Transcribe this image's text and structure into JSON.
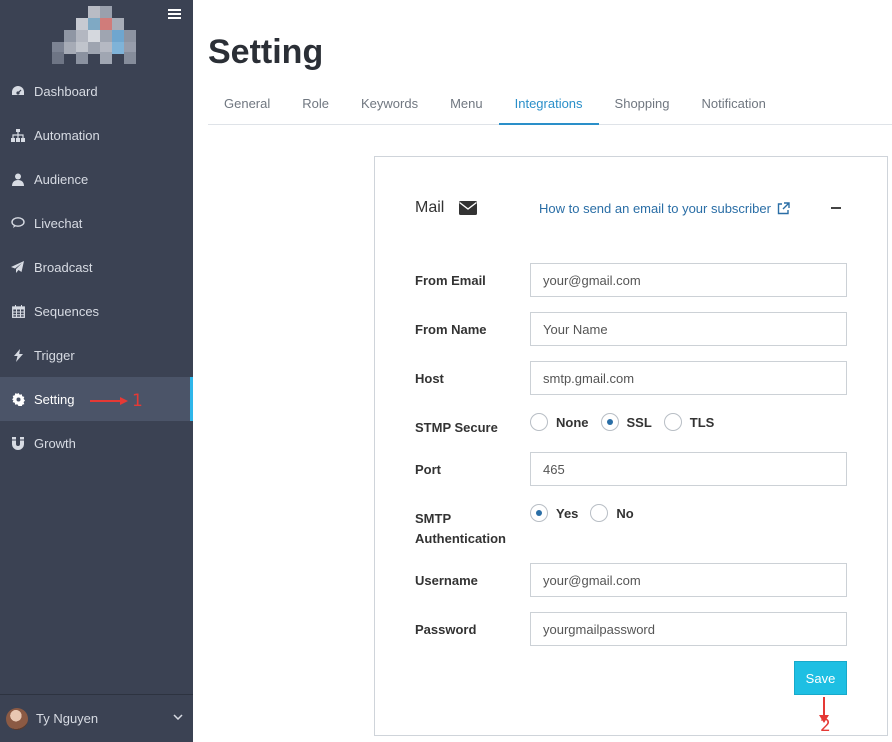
{
  "sidebar": {
    "items": [
      {
        "label": "Dashboard",
        "icon": "dashboard-icon"
      },
      {
        "label": "Automation",
        "icon": "sitemap-icon"
      },
      {
        "label": "Audience",
        "icon": "user-icon"
      },
      {
        "label": "Livechat",
        "icon": "chat-icon"
      },
      {
        "label": "Broadcast",
        "icon": "paper-plane-icon"
      },
      {
        "label": "Sequences",
        "icon": "calendar-icon"
      },
      {
        "label": "Trigger",
        "icon": "bolt-icon"
      },
      {
        "label": "Setting",
        "icon": "gear-icon"
      },
      {
        "label": "Growth",
        "icon": "magnet-icon"
      }
    ],
    "active": "Setting",
    "user_name": "Ty Nguyen"
  },
  "annotations": {
    "step1": "1",
    "step2": "2"
  },
  "page": {
    "title": "Setting"
  },
  "tabs": [
    {
      "label": "General"
    },
    {
      "label": "Role"
    },
    {
      "label": "Keywords"
    },
    {
      "label": "Menu"
    },
    {
      "label": "Integrations"
    },
    {
      "label": "Shopping"
    },
    {
      "label": "Notification"
    }
  ],
  "active_tab": "Integrations",
  "mail": {
    "title": "Mail",
    "help_link": "How to send an email to your subscriber",
    "fields": {
      "from_email": {
        "label": "From Email",
        "value": "your@gmail.com"
      },
      "from_name": {
        "label": "From Name",
        "value": "Your Name"
      },
      "host": {
        "label": "Host",
        "value": "smtp.gmail.com"
      },
      "port": {
        "label": "Port",
        "value": "465"
      },
      "username": {
        "label": "Username",
        "value": "your@gmail.com"
      },
      "password": {
        "label": "Password",
        "value": "yourgmailpassword"
      }
    },
    "secure": {
      "label": "STMP Secure",
      "options": [
        "None",
        "SSL",
        "TLS"
      ],
      "selected": "SSL"
    },
    "auth": {
      "label_line1": "SMTP",
      "label_line2": "Authentication",
      "options": [
        "Yes",
        "No"
      ],
      "selected": "Yes"
    },
    "save_label": "Save"
  },
  "colors": {
    "sidebar_bg": "#3b4253",
    "sidebar_active_bg": "#4b5468",
    "accent": "#2eb6ea",
    "link": "#2a6ea6",
    "save_button": "#1ebfe3",
    "annotation": "#e53935"
  }
}
